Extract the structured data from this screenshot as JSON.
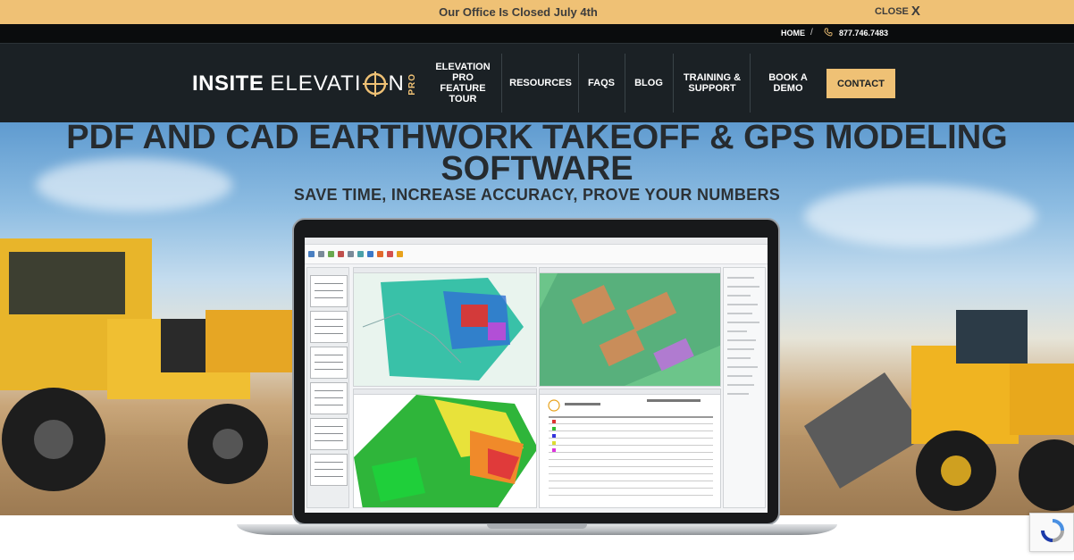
{
  "announcement": {
    "text": "Our Office Is Closed July 4th",
    "close_label": "CLOSE",
    "close_icon": "X"
  },
  "utility_bar": {
    "home_label": "HOME",
    "separator": "/",
    "phone": "877.746.7483"
  },
  "logo": {
    "word1": "INSITE",
    "word2_before": "ELEVATI",
    "word2_after": "N",
    "tag": "PRO"
  },
  "nav": {
    "items": [
      {
        "label": "ELEVATION PRO FEATURE TOUR"
      },
      {
        "label": "RESOURCES"
      },
      {
        "label": "FAQS"
      },
      {
        "label": "BLOG"
      },
      {
        "label": "TRAINING & SUPPORT"
      },
      {
        "label": "BOOK A DEMO"
      }
    ],
    "cta_label": "CONTACT"
  },
  "hero": {
    "title_line1": "PDF AND CAD EARTHWORK TAKEOFF & GPS MODELING",
    "title_line2": "SOFTWARE",
    "subtitle": "SAVE TIME, INCREASE ACCURACY, PROVE YOUR NUMBERS"
  },
  "colors": {
    "accent": "#efc175",
    "nav_bg": "#1b2125",
    "utility_bg": "#0a0c0d",
    "hero_text": "#262b2f"
  }
}
